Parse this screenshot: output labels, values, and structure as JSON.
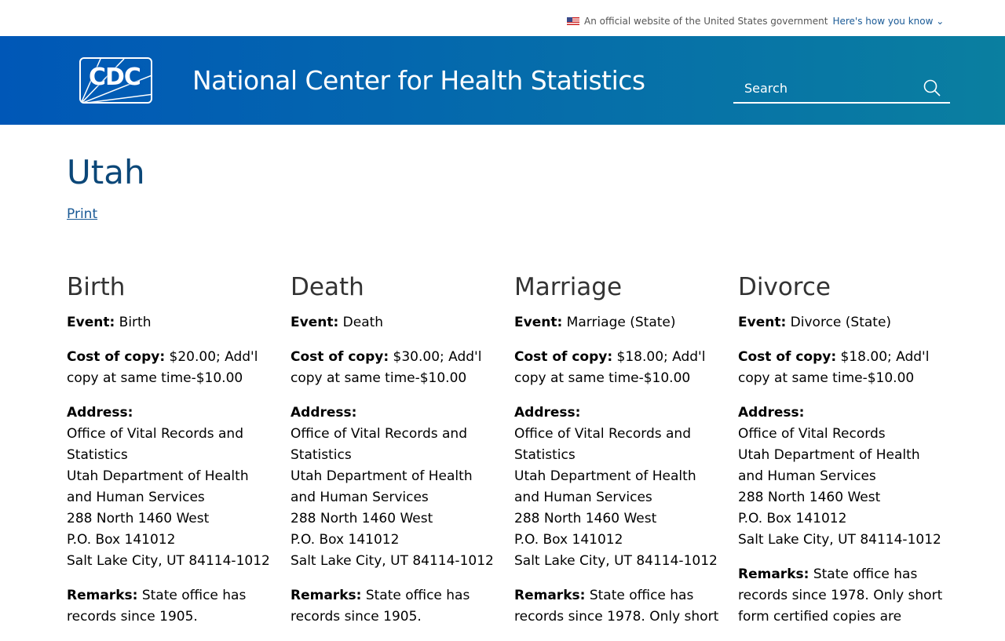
{
  "gov_banner": {
    "text": "An official website of the United States government",
    "link": "Here's how you know"
  },
  "header": {
    "logo": "CDC",
    "title": "National Center for Health Statistics",
    "search_placeholder": "Search"
  },
  "page": {
    "title": "Utah",
    "print": "Print"
  },
  "labels": {
    "event": "Event:",
    "cost": "Cost of copy:",
    "address": "Address:",
    "remarks": "Remarks:"
  },
  "columns": [
    {
      "heading": "Birth",
      "event": "Birth",
      "cost": "$20.00; Add'l copy at same time-$10.00",
      "address": [
        "Office of Vital Records and Statistics",
        "Utah Department of Health and Human Services",
        "288 North 1460 West",
        "P.O. Box 141012",
        "Salt Lake City, UT 84114-1012"
      ],
      "remarks": "State office has records since 1905."
    },
    {
      "heading": "Death",
      "event": "Death",
      "cost": "$30.00; Add'l copy at same time-$10.00",
      "address": [
        "Office of Vital Records and Statistics",
        "Utah Department of Health and Human Services",
        "288 North 1460 West",
        "P.O. Box 141012",
        "Salt Lake City, UT 84114-1012"
      ],
      "remarks": "State office has records since 1905."
    },
    {
      "heading": "Marriage",
      "event": "Marriage (State)",
      "cost": "$18.00; Add'l copy at same time-$10.00",
      "address": [
        "Office of Vital Records and Statistics",
        "Utah Department of Health and Human Services",
        "288 North 1460 West",
        "P.O. Box 141012",
        "Salt Lake City, UT 84114-1012"
      ],
      "remarks": "State office has records since 1978. Only short"
    },
    {
      "heading": "Divorce",
      "event": "Divorce (State)",
      "cost": "$18.00; Add'l copy at same time-$10.00",
      "address": [
        "Office of Vital Records",
        "Utah Department of Health and Human Services",
        "288 North 1460 West",
        "P.O. Box 141012",
        "Salt Lake City, UT 84114-1012"
      ],
      "remarks": "State office has records since 1978. Only short form certified copies are"
    }
  ]
}
